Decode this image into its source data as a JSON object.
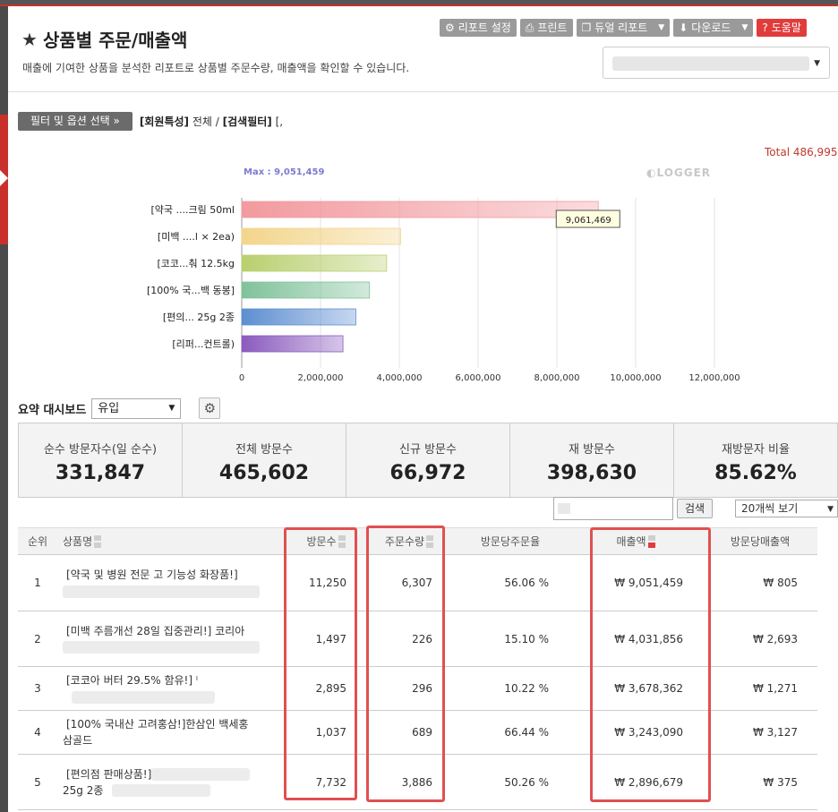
{
  "header": {
    "title": "상품별 주문/매출액",
    "description": "매출에 기여한 상품을 분석한 리포트로 상품별 주문수량, 매출액을 확인할 수 있습니다.",
    "buttons": {
      "report_settings": "리포트 설정",
      "print": "프린트",
      "dual_report": "듀얼 리포트",
      "download": "다운로드",
      "help": "도움말"
    }
  },
  "filter": {
    "button": "필터 및 옵션 선택",
    "member_label": "[회원특성]",
    "member_value": "전체 /",
    "search_label": "[검색필터]",
    "search_value": "[,"
  },
  "chart_data": {
    "type": "bar",
    "orientation": "horizontal",
    "total_label": "Total 486,995",
    "max_label": "Max : 9,051,459",
    "watermark": "LOGGER",
    "tooltip": "9,061,469",
    "categories": [
      "[약국 ....크림 50ml",
      "[미백 ....l × 2ea)",
      "[코코...춰 12.5kg",
      "[100% 국...백 동봉]",
      "[편의... 25g 2종",
      "[리퍼...컨트롤)"
    ],
    "values": [
      9051459,
      4031856,
      3678362,
      3243090,
      2896679,
      2570000
    ],
    "colors": [
      "#f29a9f",
      "#f3d58b",
      "#b9cf6f",
      "#7fc29a",
      "#5d8ed1",
      "#8a5bbd"
    ],
    "xlim": [
      0,
      12000000
    ],
    "xticks": [
      "0",
      "2,000,000",
      "4,000,000",
      "6,000,000",
      "8,000,000",
      "10,000,000",
      "12,000,000"
    ],
    "grid": true
  },
  "summary": {
    "label": "요약 대시보드",
    "select": "유입"
  },
  "stats": [
    {
      "label": "순수 방문자수(일 순수)",
      "value": "331,847"
    },
    {
      "label": "전체 방문수",
      "value": "465,602"
    },
    {
      "label": "신규 방문수",
      "value": "66,972"
    },
    {
      "label": "재 방문수",
      "value": "398,630"
    },
    {
      "label": "재방문자 비율",
      "value": "85.62%"
    }
  ],
  "search": {
    "button": "검색",
    "page_size": "20개씩 보기"
  },
  "table": {
    "headers": {
      "rank": "순위",
      "name": "상품명",
      "visits": "방문수",
      "orders": "주문수량",
      "conv": "방문당주문율",
      "sales": "매출액",
      "per_visit": "방문당매출액"
    },
    "rows": [
      {
        "rank": "1",
        "name1": "[약국 및 병원 전문 고 기능성 화장품!]",
        "name2": "",
        "visits": "11,250",
        "orders": "6,307",
        "conv": "56.06 %",
        "sales": "₩ 9,051,459",
        "per_visit": "₩ 805"
      },
      {
        "rank": "2",
        "name1": "[미백 주름개선 28일 집중관리!] 코리아",
        "name2": "",
        "visits": "1,497",
        "orders": "226",
        "conv": "15.10 %",
        "sales": "₩ 4,031,856",
        "per_visit": "₩ 2,693"
      },
      {
        "rank": "3",
        "name1": "[코코아 버터 29.5% 함유!] ˡ",
        "name2": "",
        "visits": "2,895",
        "orders": "296",
        "conv": "10.22 %",
        "sales": "₩ 3,678,362",
        "per_visit": "₩ 1,271"
      },
      {
        "rank": "4",
        "name1": "[100% 국내산 고려홍삼!]한삼인 백세홍",
        "name2": "삼골드",
        "visits": "1,037",
        "orders": "689",
        "conv": "66.44 %",
        "sales": "₩ 3,243,090",
        "per_visit": "₩ 3,127"
      },
      {
        "rank": "5",
        "name1": "[편의점 판매상품!]",
        "name2": "25g 2종",
        "visits": "7,732",
        "orders": "3,886",
        "conv": "50.26 %",
        "sales": "₩ 2,896,679",
        "per_visit": "₩ 375"
      }
    ]
  }
}
